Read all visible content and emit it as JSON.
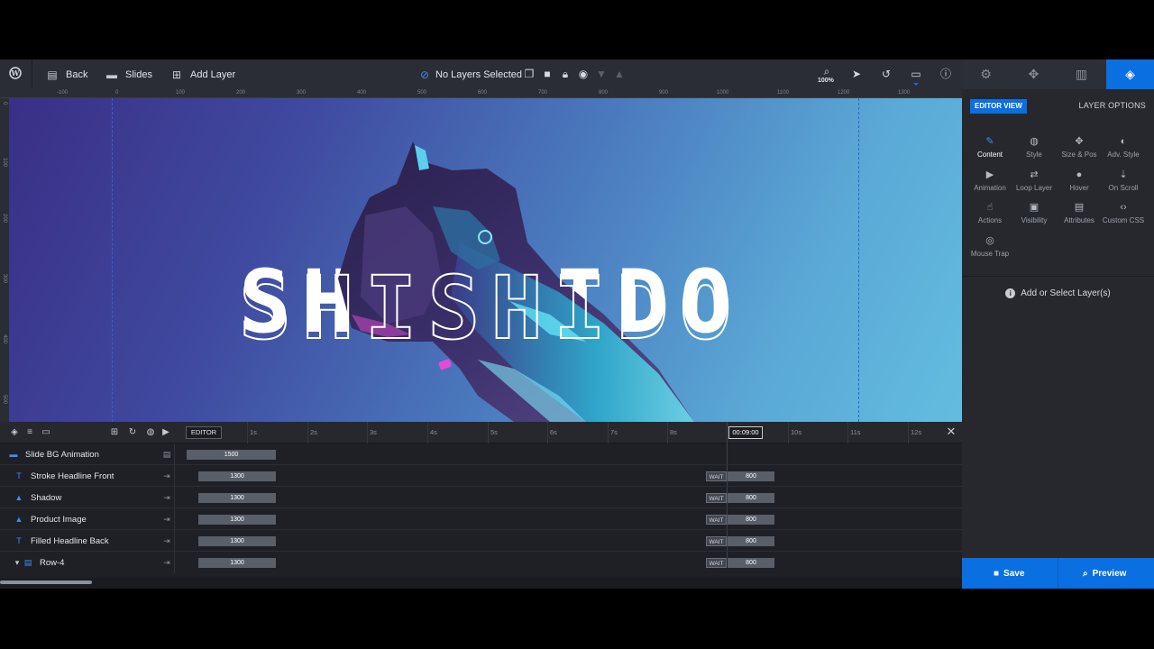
{
  "toolbar": {
    "back_label": "Back",
    "slides_label": "Slides",
    "add_layer_label": "Add Layer",
    "selection_status": "No Layers Selected",
    "zoom": "100%"
  },
  "ruler": {
    "h_labels": [
      "-100",
      "0",
      "100",
      "200",
      "300",
      "400",
      "500",
      "600",
      "700",
      "800",
      "900",
      "1000",
      "1100",
      "1200",
      "1300"
    ],
    "v_labels": [
      "0",
      "100",
      "200",
      "300",
      "400",
      "500",
      "600"
    ]
  },
  "canvas": {
    "headline": "SHISHIDO"
  },
  "right_panel": {
    "editor_view": "EDITOR VIEW",
    "layer_options": "LAYER OPTIONS",
    "options": [
      "Content",
      "Style",
      "Size & Pos",
      "Adv. Style",
      "Animation",
      "Loop Layer",
      "Hover",
      "On Scroll",
      "Actions",
      "Visibility",
      "Attributes",
      "Custom CSS",
      "Mouse Trap"
    ],
    "hint": "Add or Select Layer(s)",
    "save_label": "Save",
    "preview_label": "Preview"
  },
  "timeline": {
    "editor_tag": "EDITOR",
    "seconds": [
      "1s",
      "2s",
      "3s",
      "4s",
      "5s",
      "6s",
      "7s",
      "8s",
      "10s",
      "11s",
      "12s"
    ],
    "current_time": "00:09:00",
    "wait_label": "WAIT",
    "rows": [
      {
        "name": "Slide BG Animation",
        "duration": "1500"
      },
      {
        "name": "Stroke Headline Front",
        "duration": "1300",
        "end_duration": "800"
      },
      {
        "name": "Shadow",
        "duration": "1300",
        "end_duration": "800"
      },
      {
        "name": "Product Image",
        "duration": "1300",
        "end_duration": "800"
      },
      {
        "name": "Filled Headline Back",
        "duration": "1300",
        "end_duration": "800"
      },
      {
        "name": "Row-4",
        "duration": "1300",
        "end_duration": "800"
      }
    ]
  },
  "colors": {
    "accent": "#0a6fe0",
    "panel": "#26282e",
    "toolbar": "#2a2d33"
  }
}
